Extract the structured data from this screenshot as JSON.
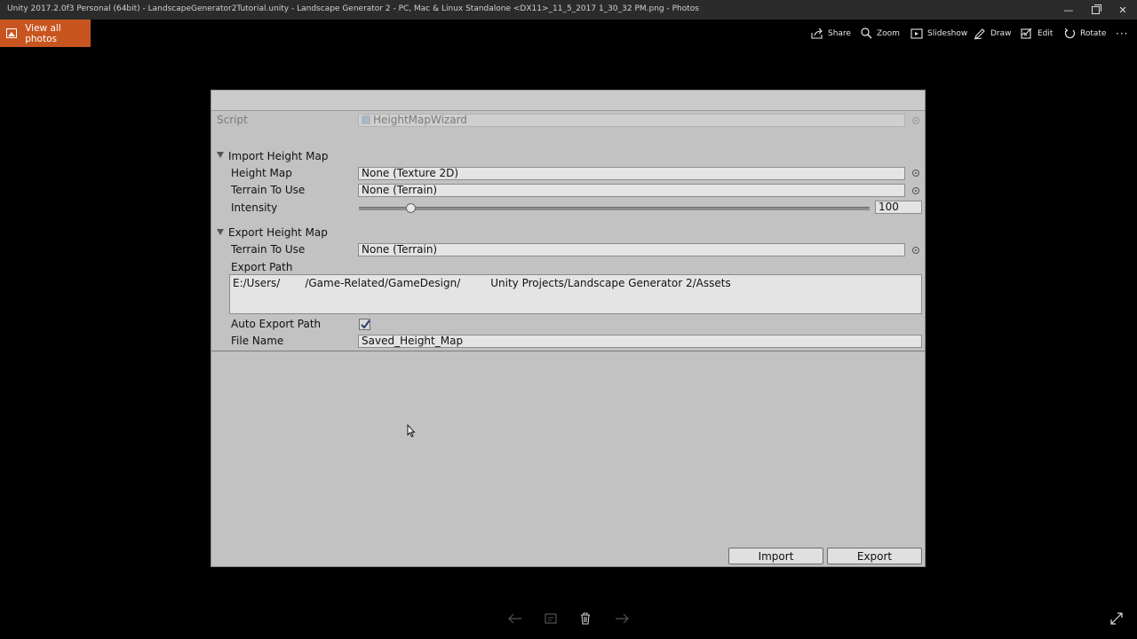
{
  "window": {
    "title": "Unity 2017.2.0f3 Personal (64bit) - LandscapeGenerator2Tutorial.unity - Landscape Generator 2 - PC, Mac & Linux Standalone <DX11>_11_5_2017 1_30_32 PM.png - Photos",
    "minimize_glyph": "—",
    "close_glyph": "✕"
  },
  "toolbar": {
    "view_all": "View all photos",
    "share": "Share",
    "zoom": "Zoom",
    "slideshow": "Slideshow",
    "draw": "Draw",
    "edit": "Edit",
    "rotate": "Rotate",
    "more": "···"
  },
  "inspector": {
    "script_label": "Script",
    "script_value": "HeightMapWizard",
    "import_header": "Import Height Map",
    "height_map_label": "Height Map",
    "height_map_value": "None (Texture 2D)",
    "terrain_label": "Terrain To Use",
    "terrain_value": "None (Terrain)",
    "intensity_label": "Intensity",
    "intensity_value": "100",
    "intensity_fraction": 0.1,
    "export_header": "Export Height Map",
    "export_terrain_label": "Terrain To Use",
    "export_terrain_value": "None (Terrain)",
    "export_path_label": "Export Path",
    "export_path_part1": "E:/Users/",
    "export_path_part2": "/Game-Related/GameDesign/",
    "export_path_part3": "Unity Projects/Landscape Generator 2/Assets",
    "auto_export_label": "Auto Export Path",
    "auto_export_checked": true,
    "file_name_label": "File Name",
    "file_name_value": "Saved_Height_Map",
    "import_button": "Import",
    "export_button": "Export"
  }
}
